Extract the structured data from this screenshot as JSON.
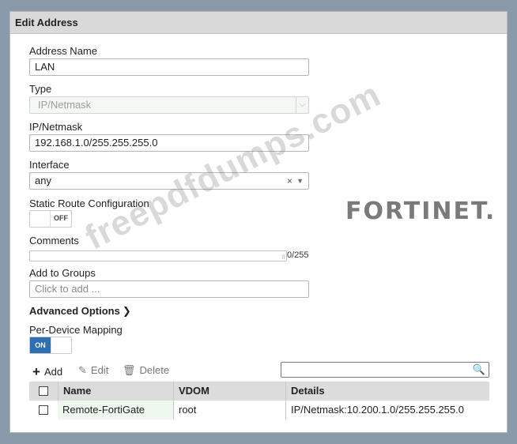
{
  "dialog": {
    "title": "Edit Address"
  },
  "address_name": {
    "label": "Address Name",
    "value": "LAN"
  },
  "type": {
    "label": "Type",
    "value": "IP/Netmask"
  },
  "ip_netmask": {
    "label": "IP/Netmask",
    "value": "192.168.1.0/255.255.255.0"
  },
  "interface": {
    "label": "Interface",
    "value": "any",
    "clear_icon": "×",
    "dropdown_icon": "▼"
  },
  "static_route": {
    "label": "Static Route Configuration",
    "state": "OFF"
  },
  "comments": {
    "label": "Comments",
    "counter": "0/255"
  },
  "add_to_groups": {
    "label": "Add to Groups",
    "placeholder": "Click to add ..."
  },
  "advanced_options": {
    "label": "Advanced Options",
    "chevron": "❯"
  },
  "per_device_mapping": {
    "label": "Per-Device Mapping",
    "state": "ON"
  },
  "toolbar": {
    "add_label": "Add",
    "edit_label": "Edit",
    "delete_label": "Delete"
  },
  "table": {
    "columns": [
      "Name",
      "VDOM",
      "Details"
    ],
    "rows": [
      {
        "name": "Remote-FortiGate",
        "vdom": "root",
        "details": "IP/Netmask:10.200.1.0/255.255.255.0"
      }
    ]
  },
  "watermark": "freepdfdumps.com",
  "logo": "FORTINET.",
  "colors": {
    "accent": "#2e6fb3",
    "titlebar": "#d9d9d9",
    "row_highlight": "#eef7ee"
  }
}
